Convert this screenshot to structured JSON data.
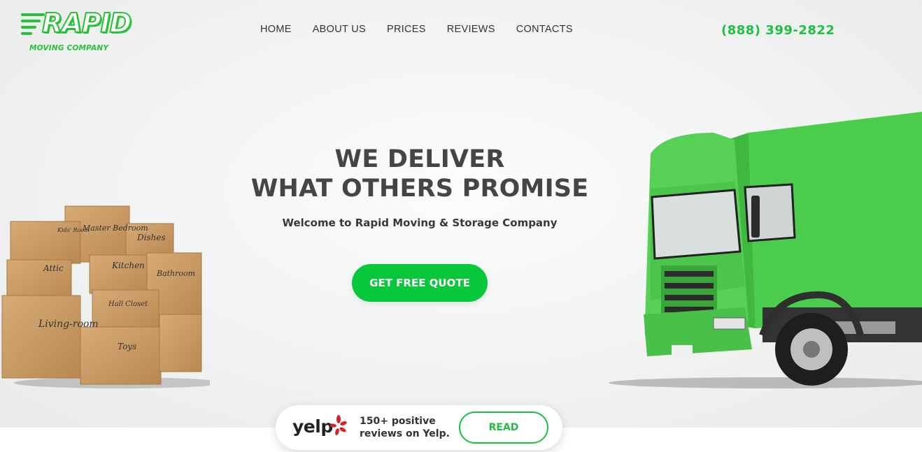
{
  "brand": {
    "logo_word": "RAPID",
    "logo_sub": "MOVING COMPANY",
    "accent_color": "#1fbf40",
    "cta_color": "#09c73b"
  },
  "nav": {
    "items": [
      {
        "label": "HOME"
      },
      {
        "label": "ABOUT US"
      },
      {
        "label": "PRICES"
      },
      {
        "label": "REVIEWS"
      },
      {
        "label": "CONTACTS"
      }
    ]
  },
  "header": {
    "phone": "(888) 399-2822"
  },
  "hero": {
    "headline_line1": "WE DELIVER",
    "headline_line2": "WHAT OTHERS PROMISE",
    "subheadline": "Welcome to Rapid Moving & Storage Company",
    "cta_label": "GET FREE QUOTE",
    "box_labels": [
      "Master Bedroom",
      "Kids' Room",
      "Dishes",
      "Attic",
      "Kitchen",
      "Bathroom",
      "Hall Closet",
      "Living-room",
      "Toys"
    ]
  },
  "reviews": {
    "yelp_logo": "yelp",
    "text_line1": "150+ positive",
    "text_line2": "reviews on Yelp.",
    "read_label": "READ"
  },
  "icons": {
    "yelp": "yelp-burst-icon",
    "logo": "speed-streaks-icon"
  }
}
